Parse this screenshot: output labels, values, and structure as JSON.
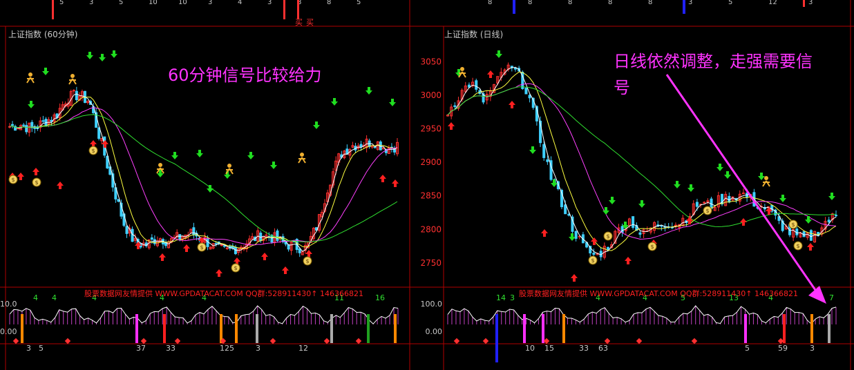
{
  "colors": {
    "background": "#000000",
    "frame": "#b00000",
    "up_candle": "#ff3030",
    "down_candle": "#3fd0ff",
    "ma_white": "#ffffff",
    "ma_yellow": "#ffff40",
    "ma_magenta": "#ff40ff",
    "ma_green": "#30e030",
    "signal_up": "#ff2020",
    "signal_down": "#20dd20",
    "annotation": "#ff33ff",
    "arrow": "#ff33ff"
  },
  "top_strip": {
    "left_numbers": [
      "5",
      "3",
      "5",
      "10",
      "10",
      "3",
      "4",
      "3",
      "8",
      "8",
      "5"
    ],
    "right_numbers": [
      "8",
      "8",
      "8",
      "8",
      "8",
      "3",
      "5",
      "12",
      "3"
    ],
    "buy_labels": [
      "买",
      "买"
    ]
  },
  "left_panel": {
    "title": "上证指数 (60分钟)",
    "annotation": "60分钟信号比较给力",
    "banner": "股票数据网友情提供 WWW.GPDATACAT.COM QQ群:528911430↑ 146366821",
    "osc_labels": [
      "10.0",
      "0.00"
    ],
    "bottom_numbers": [
      "3",
      "5",
      "37",
      "33",
      "125",
      "3",
      "12"
    ],
    "top_numbers": [
      "4",
      "4",
      "4",
      "4",
      "4",
      "11",
      "16"
    ]
  },
  "right_panel": {
    "title": "上证指数 (日线)",
    "annotation_line1": "日线依然调整，走强需要信",
    "annotation_line2": "号",
    "banner": "股票数据网友情提供 WWW.GPDATACAT.COM QQ群:528911430↑ 146366821",
    "osc_labels": [
      "100.0",
      "0.00"
    ],
    "bottom_numbers": [
      "10",
      "15",
      "33",
      "63",
      "5",
      "59",
      "3"
    ],
    "top_numbers": [
      "14",
      "3",
      "4",
      "4",
      "5",
      "13",
      "4",
      "7"
    ]
  },
  "chart_data": [
    {
      "type": "line",
      "panel": "left",
      "title": "上证指数 (60分钟)",
      "series": [
        {
          "values": [
            2978,
            2980,
            2975,
            2983,
            2990,
            3012,
            3016,
            3008,
            2960,
            2910,
            2862,
            2838,
            2836,
            2845,
            2840,
            2846,
            2850,
            2843,
            2832,
            2828,
            2833,
            2840,
            2848,
            2845,
            2838,
            2834,
            2832,
            2860,
            2910,
            2945,
            2955,
            2958,
            2960,
            2952,
            2955
          ]
        }
      ]
    },
    {
      "type": "line",
      "panel": "right",
      "title": "上证指数 (日线)",
      "ylim": [
        2720,
        3070
      ],
      "y_ticks": [
        2750,
        2800,
        2850,
        2900,
        2950,
        3000,
        3050
      ],
      "series": [
        {
          "values": [
            2975,
            3000,
            3020,
            2990,
            3010,
            3040,
            3035,
            3005,
            2940,
            2880,
            2840,
            2800,
            2770,
            2760,
            2775,
            2800,
            2815,
            2790,
            2805,
            2810,
            2808,
            2820,
            2840,
            2835,
            2845,
            2850,
            2852,
            2838,
            2830,
            2810,
            2795,
            2785,
            2790,
            2810,
            2820
          ]
        }
      ]
    }
  ]
}
